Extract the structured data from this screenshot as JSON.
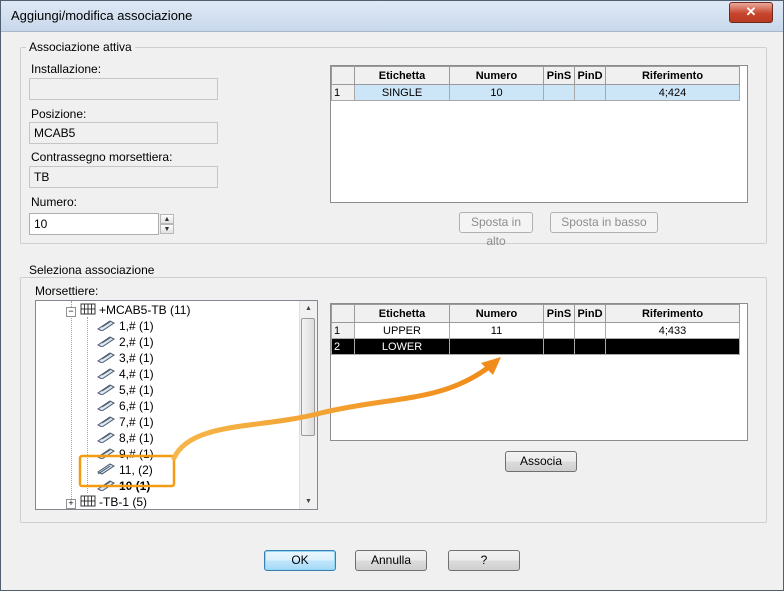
{
  "window": {
    "title": "Aggiungi/modifica associazione",
    "close_label": "✕"
  },
  "active": {
    "group_label": "Associazione attiva",
    "installation_label": "Installazione:",
    "installation_value": "",
    "position_label": "Posizione:",
    "position_value": "MCAB5",
    "terminal_strip_label": "Contrassegno morsettiera:",
    "terminal_strip_value": "TB",
    "number_label": "Numero:",
    "number_value": "10",
    "columns": [
      "Etichetta",
      "Numero",
      "PinS",
      "PinD",
      "Riferimento"
    ],
    "rows": [
      {
        "n": "1",
        "etichetta": "SINGLE",
        "numero": "10",
        "pins": "",
        "pind": "",
        "riferimento": "4;424"
      }
    ],
    "move_up_label": "Sposta in alto",
    "move_down_label": "Sposta in basso"
  },
  "select": {
    "group_label": "Seleziona associazione",
    "strips_label": "Morsettiere:",
    "tree": {
      "root": "+MCAB5-TB (11)",
      "items": [
        "1,# (1)",
        "2,# (1)",
        "3,# (1)",
        "4,# (1)",
        "5,# (1)",
        "6,# (1)",
        "7,# (1)",
        "8,# (1)",
        "9,# (1)",
        "11,  (2)",
        "10 (1)"
      ],
      "next_root": "-TB-1 (5)"
    },
    "columns": [
      "Etichetta",
      "Numero",
      "PinS",
      "PinD",
      "Riferimento"
    ],
    "rows": [
      {
        "n": "1",
        "etichetta": "UPPER",
        "numero": "11",
        "pins": "",
        "pind": "",
        "riferimento": "4;433"
      },
      {
        "n": "2",
        "etichetta": "LOWER",
        "numero": "",
        "pins": "",
        "pind": "",
        "riferimento": ""
      }
    ],
    "associate_label": "Associa"
  },
  "footer": {
    "ok_label": "OK",
    "cancel_label": "Annulla",
    "help_label": "?"
  },
  "colors": {
    "highlight_orange": "#f39c12",
    "selection_blue": "#cde6f7"
  }
}
